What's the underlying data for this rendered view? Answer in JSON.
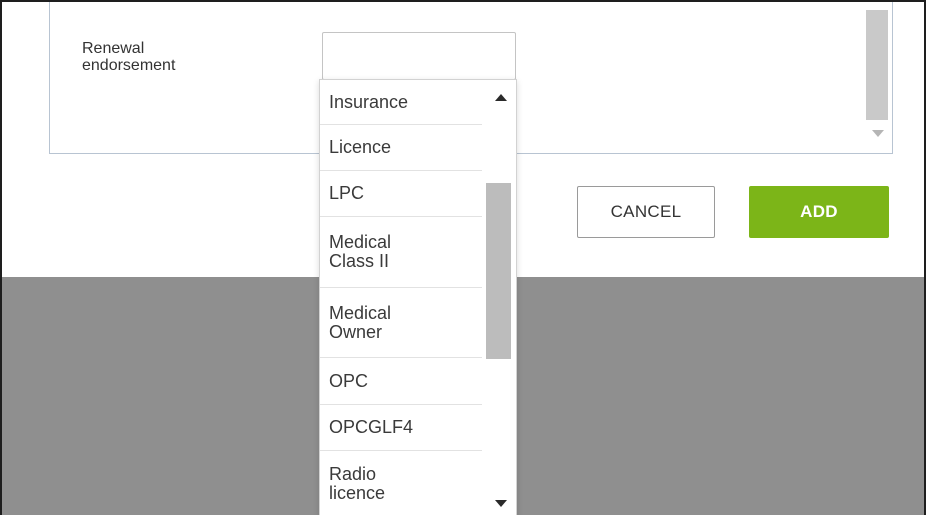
{
  "form": {
    "renewal_endorsement_label": "Renewal\nendorsement",
    "renewal_endorsement_value": ""
  },
  "dropdown": {
    "options": [
      "Insurance",
      "Licence",
      "LPC",
      "Medical\nClass II",
      "Medical\nOwner",
      "OPC",
      "OPCGLF4",
      "Radio\nlicence"
    ]
  },
  "buttons": {
    "cancel_label": "CANCEL",
    "add_label": "ADD"
  },
  "colors": {
    "add_button": "#7cb518",
    "overlay": "#8f8f8f",
    "panel_border": "#b8c4d2"
  },
  "icons": {
    "dropdown_scroll_up": "triangle-up",
    "dropdown_scroll_down": "triangle-down",
    "panel_scroll_down": "triangle-down"
  }
}
